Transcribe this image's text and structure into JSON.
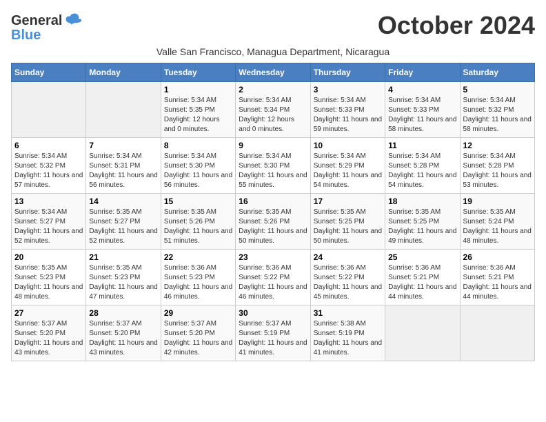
{
  "header": {
    "logo_line1": "General",
    "logo_line2": "Blue",
    "month_title": "October 2024",
    "subtitle": "Valle San Francisco, Managua Department, Nicaragua"
  },
  "weekdays": [
    "Sunday",
    "Monday",
    "Tuesday",
    "Wednesday",
    "Thursday",
    "Friday",
    "Saturday"
  ],
  "weeks": [
    [
      {
        "day": "",
        "info": ""
      },
      {
        "day": "",
        "info": ""
      },
      {
        "day": "1",
        "info": "Sunrise: 5:34 AM\nSunset: 5:35 PM\nDaylight: 12 hours and 0 minutes."
      },
      {
        "day": "2",
        "info": "Sunrise: 5:34 AM\nSunset: 5:34 PM\nDaylight: 12 hours and 0 minutes."
      },
      {
        "day": "3",
        "info": "Sunrise: 5:34 AM\nSunset: 5:33 PM\nDaylight: 11 hours and 59 minutes."
      },
      {
        "day": "4",
        "info": "Sunrise: 5:34 AM\nSunset: 5:33 PM\nDaylight: 11 hours and 58 minutes."
      },
      {
        "day": "5",
        "info": "Sunrise: 5:34 AM\nSunset: 5:32 PM\nDaylight: 11 hours and 58 minutes."
      }
    ],
    [
      {
        "day": "6",
        "info": "Sunrise: 5:34 AM\nSunset: 5:32 PM\nDaylight: 11 hours and 57 minutes."
      },
      {
        "day": "7",
        "info": "Sunrise: 5:34 AM\nSunset: 5:31 PM\nDaylight: 11 hours and 56 minutes."
      },
      {
        "day": "8",
        "info": "Sunrise: 5:34 AM\nSunset: 5:30 PM\nDaylight: 11 hours and 56 minutes."
      },
      {
        "day": "9",
        "info": "Sunrise: 5:34 AM\nSunset: 5:30 PM\nDaylight: 11 hours and 55 minutes."
      },
      {
        "day": "10",
        "info": "Sunrise: 5:34 AM\nSunset: 5:29 PM\nDaylight: 11 hours and 54 minutes."
      },
      {
        "day": "11",
        "info": "Sunrise: 5:34 AM\nSunset: 5:28 PM\nDaylight: 11 hours and 54 minutes."
      },
      {
        "day": "12",
        "info": "Sunrise: 5:34 AM\nSunset: 5:28 PM\nDaylight: 11 hours and 53 minutes."
      }
    ],
    [
      {
        "day": "13",
        "info": "Sunrise: 5:34 AM\nSunset: 5:27 PM\nDaylight: 11 hours and 52 minutes."
      },
      {
        "day": "14",
        "info": "Sunrise: 5:35 AM\nSunset: 5:27 PM\nDaylight: 11 hours and 52 minutes."
      },
      {
        "day": "15",
        "info": "Sunrise: 5:35 AM\nSunset: 5:26 PM\nDaylight: 11 hours and 51 minutes."
      },
      {
        "day": "16",
        "info": "Sunrise: 5:35 AM\nSunset: 5:26 PM\nDaylight: 11 hours and 50 minutes."
      },
      {
        "day": "17",
        "info": "Sunrise: 5:35 AM\nSunset: 5:25 PM\nDaylight: 11 hours and 50 minutes."
      },
      {
        "day": "18",
        "info": "Sunrise: 5:35 AM\nSunset: 5:25 PM\nDaylight: 11 hours and 49 minutes."
      },
      {
        "day": "19",
        "info": "Sunrise: 5:35 AM\nSunset: 5:24 PM\nDaylight: 11 hours and 48 minutes."
      }
    ],
    [
      {
        "day": "20",
        "info": "Sunrise: 5:35 AM\nSunset: 5:23 PM\nDaylight: 11 hours and 48 minutes."
      },
      {
        "day": "21",
        "info": "Sunrise: 5:35 AM\nSunset: 5:23 PM\nDaylight: 11 hours and 47 minutes."
      },
      {
        "day": "22",
        "info": "Sunrise: 5:36 AM\nSunset: 5:23 PM\nDaylight: 11 hours and 46 minutes."
      },
      {
        "day": "23",
        "info": "Sunrise: 5:36 AM\nSunset: 5:22 PM\nDaylight: 11 hours and 46 minutes."
      },
      {
        "day": "24",
        "info": "Sunrise: 5:36 AM\nSunset: 5:22 PM\nDaylight: 11 hours and 45 minutes."
      },
      {
        "day": "25",
        "info": "Sunrise: 5:36 AM\nSunset: 5:21 PM\nDaylight: 11 hours and 44 minutes."
      },
      {
        "day": "26",
        "info": "Sunrise: 5:36 AM\nSunset: 5:21 PM\nDaylight: 11 hours and 44 minutes."
      }
    ],
    [
      {
        "day": "27",
        "info": "Sunrise: 5:37 AM\nSunset: 5:20 PM\nDaylight: 11 hours and 43 minutes."
      },
      {
        "day": "28",
        "info": "Sunrise: 5:37 AM\nSunset: 5:20 PM\nDaylight: 11 hours and 43 minutes."
      },
      {
        "day": "29",
        "info": "Sunrise: 5:37 AM\nSunset: 5:20 PM\nDaylight: 11 hours and 42 minutes."
      },
      {
        "day": "30",
        "info": "Sunrise: 5:37 AM\nSunset: 5:19 PM\nDaylight: 11 hours and 41 minutes."
      },
      {
        "day": "31",
        "info": "Sunrise: 5:38 AM\nSunset: 5:19 PM\nDaylight: 11 hours and 41 minutes."
      },
      {
        "day": "",
        "info": ""
      },
      {
        "day": "",
        "info": ""
      }
    ]
  ]
}
